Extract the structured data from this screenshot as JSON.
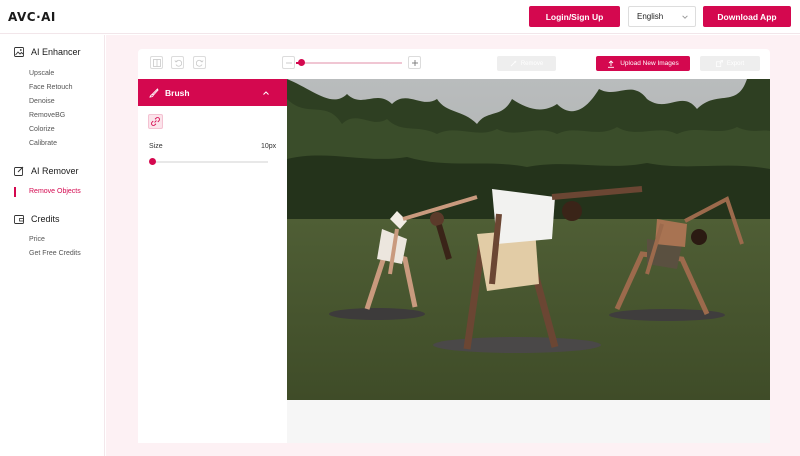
{
  "header": {
    "logo": "AVC·AI",
    "login_label": "Login/Sign Up",
    "language": "English",
    "download_label": "Download App"
  },
  "sidebar": {
    "sections": [
      {
        "title": "AI Enhancer",
        "icon": "image-icon",
        "items": [
          "Upscale",
          "Face Retouch",
          "Denoise",
          "RemoveBG",
          "Colorize",
          "Calibrate"
        ]
      },
      {
        "title": "AI Remover",
        "icon": "edit-icon",
        "items": [
          "Remove Objects"
        ]
      },
      {
        "title": "Credits",
        "icon": "wallet-icon",
        "items": [
          "Price",
          "Get Free Credits"
        ]
      }
    ],
    "active_item": "Remove Objects"
  },
  "toolbar": {
    "remove_label": "Remove",
    "upload_label": "Upload New Images",
    "export_label": "Export",
    "zoom_level": 0.05
  },
  "tool_panel": {
    "title": "Brush",
    "size_label": "Size",
    "size_value": "10px",
    "size_slider_level": 0.0
  },
  "colors": {
    "accent": "#d4084f",
    "background": "#fdf1f4"
  }
}
